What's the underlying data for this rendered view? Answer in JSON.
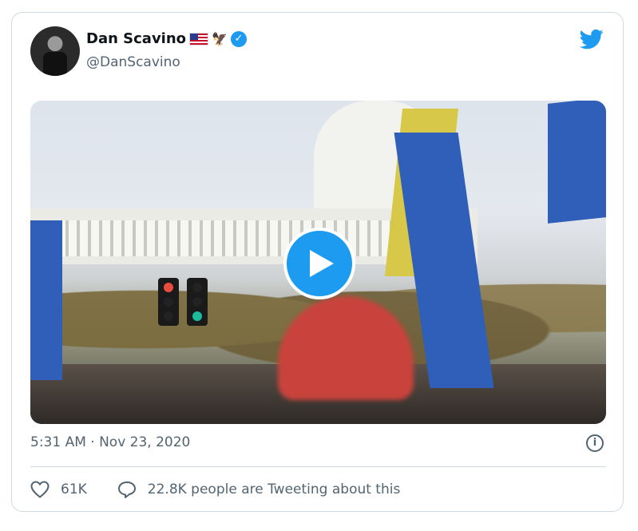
{
  "tweet": {
    "author_name": "Dan Scavino",
    "handle": "@DanScavino",
    "timestamp": "5:31 AM · Nov 23, 2020",
    "likes": "61K",
    "tweeting_about": "22.8K people are Tweeting about this"
  },
  "icons": {
    "logo": "twitter-bird-icon",
    "verified": "verified-badge-icon",
    "play": "play-icon",
    "info": "info-icon",
    "like": "heart-icon",
    "reply": "speech-bubble-icon"
  },
  "colors": {
    "accent": "#1d9bf0",
    "secondary_text": "#536471",
    "border": "#cfd9de"
  }
}
